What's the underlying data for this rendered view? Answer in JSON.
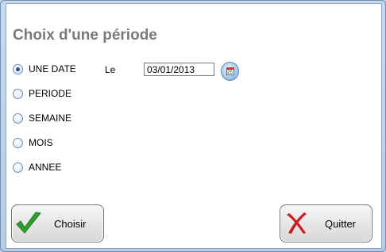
{
  "dialog": {
    "heading": "Choix d'une période",
    "options": [
      {
        "label": "UNE DATE",
        "checked": true
      },
      {
        "label": "PERIODE",
        "checked": false
      },
      {
        "label": "SEMAINE",
        "checked": false
      },
      {
        "label": "MOIS",
        "checked": false
      },
      {
        "label": "ANNEE",
        "checked": false
      }
    ],
    "date_label": "Le",
    "date_value": "03/01/2013",
    "calendar_icon": "calendar-icon"
  },
  "buttons": {
    "choose_label": "Choisir",
    "quit_label": "Quitter"
  },
  "colors": {
    "heading": "#7a7a7a",
    "check_green": "#2ea02e",
    "cross_red": "#d01a1a"
  }
}
